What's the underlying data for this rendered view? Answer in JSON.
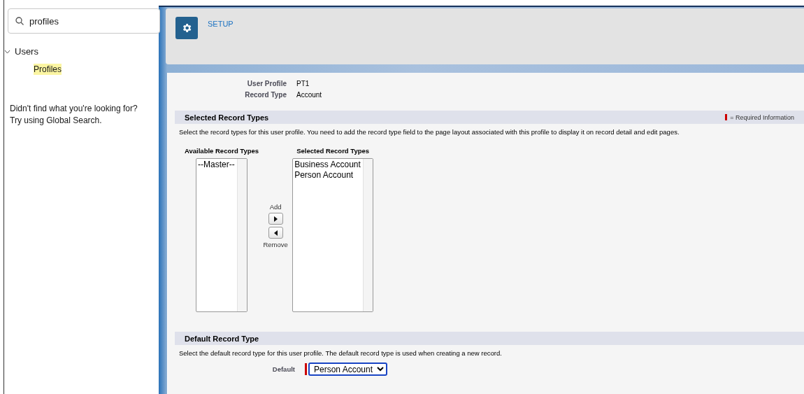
{
  "sidebar": {
    "search": {
      "value": "profiles"
    },
    "tree": [
      {
        "label": "Users",
        "expanded": true,
        "children": [
          {
            "label": "Profiles",
            "selected": true
          }
        ]
      }
    ],
    "help": [
      "Didn't find what you're looking for?",
      "Try using Global Search."
    ]
  },
  "header": {
    "title": "SETUP"
  },
  "details": [
    {
      "label": "User Profile",
      "value": "PT1"
    },
    {
      "label": "Record Type",
      "value": "Account"
    }
  ],
  "selected_section": {
    "title": "Selected Record Types",
    "required_legend": "= Required Information",
    "description": "Select the record types for this user profile. You need to add the record type field to the page layout associated with this profile to display it on record detail and edit pages.",
    "available": {
      "title": "Available Record Types",
      "items": [
        "--Master--"
      ]
    },
    "add_label": "Add",
    "remove_label": "Remove",
    "selected": {
      "title": "Selected Record Types",
      "items": [
        "Business Account",
        "Person Account"
      ]
    }
  },
  "default_section": {
    "title": "Default Record Type",
    "description": "Select the default record type for this user profile. The default record type is used when creating a new record.",
    "field_label": "Default",
    "value": "Person Account",
    "required": true
  }
}
